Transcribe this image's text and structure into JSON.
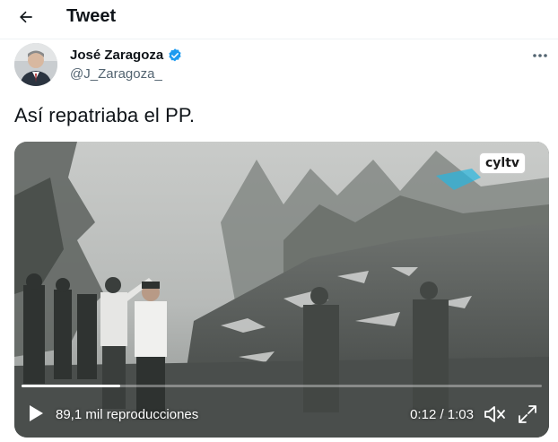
{
  "header": {
    "title": "Tweet",
    "back_icon": "arrow-left-icon"
  },
  "author": {
    "name": "José Zaragoza",
    "handle": "@J_Zaragoza_",
    "verified": true,
    "verified_color": "#1d9bf0",
    "more_icon": "more-horizontal-icon"
  },
  "tweet": {
    "text": "Así repatriaba el PP."
  },
  "video": {
    "channel_logo": "cyltv",
    "views_label": "89,1 mil reproducciones",
    "time_label": "0:12 / 1:03",
    "progress_fraction": 0.19,
    "play_icon": "play-icon",
    "mute_icon": "volume-muted-icon",
    "fullscreen_icon": "fullscreen-icon"
  }
}
